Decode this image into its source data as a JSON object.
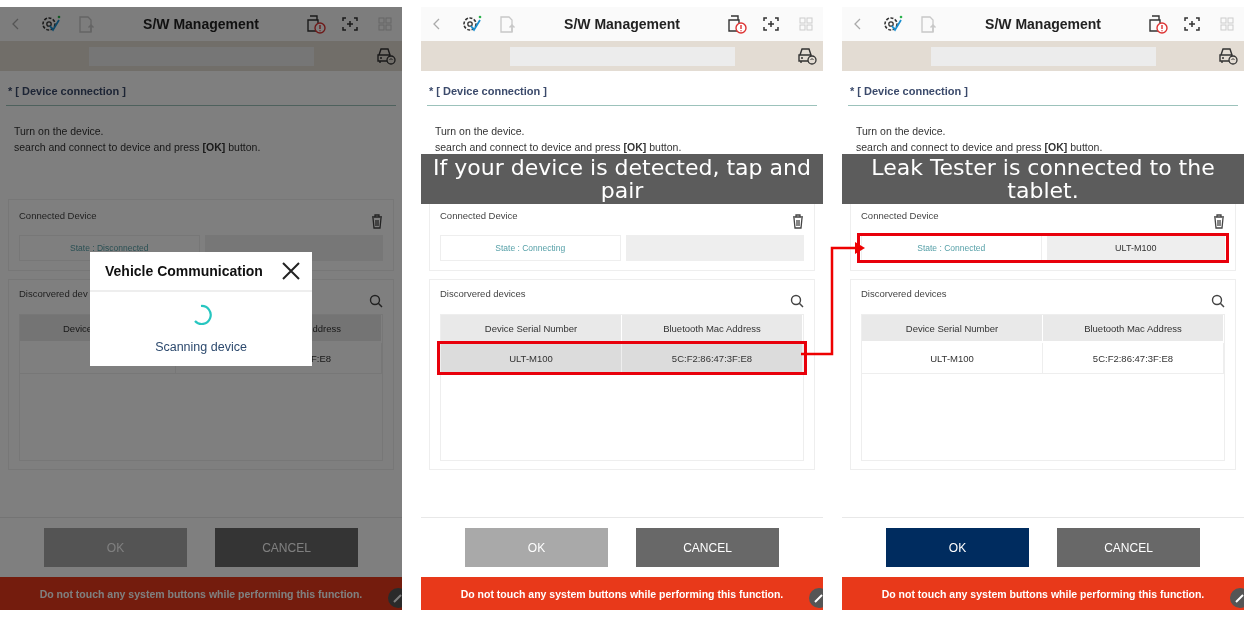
{
  "panels": [
    {
      "title": "S/W Management",
      "section": "* [ Device connection ]",
      "instructions": [
        "Turn on the device.",
        "search and connect to device and press **[OK]** button."
      ],
      "connected": {
        "title": "Connected Device",
        "state": "State : Disconnected",
        "highlighted": false
      },
      "discovered": {
        "title": "Discorvered dev",
        "columns": [
          "Device",
          "ddress"
        ],
        "rows": [
          {
            "mac": "F:E8",
            "selected": false,
            "highlighted": false
          }
        ]
      },
      "buttons": {
        "ok": "OK",
        "cancel": "CANCEL",
        "ok_enabled": false
      },
      "warning": "Do not touch any system buttons while performing this function.",
      "dimmed": true,
      "dialog": {
        "title": "Vehicle Communication",
        "message": "Scanning device"
      }
    },
    {
      "title": "S/W Management",
      "section": "* [ Device connection ]",
      "instructions": [
        "Turn on the device.",
        "search and connect to device and press **[OK]** button."
      ],
      "caption": "If your device is detected, tap and pair",
      "connected": {
        "title": "Connected Device",
        "state": "State : Connecting",
        "highlighted": false
      },
      "discovered": {
        "title": "Discorvered devices",
        "columns": [
          "Device Serial Number",
          "Bluetooth Mac Address"
        ],
        "rows": [
          {
            "serial": "ULT-M100",
            "mac": "5C:F2:86:47:3F:E8",
            "selected": true,
            "highlighted": true
          }
        ]
      },
      "buttons": {
        "ok": "OK",
        "cancel": "CANCEL",
        "ok_enabled": false
      },
      "warning": "Do not touch any system buttons while performing this function.",
      "dimmed": false
    },
    {
      "title": "S/W Management",
      "section": "* [ Device connection ]",
      "instructions": [
        "Turn on the device.",
        "search and connect to device and press **[OK]** button."
      ],
      "caption": "Leak Tester is connected to the tablet.",
      "connected": {
        "title": "Connected Device",
        "state": "State : Connected",
        "device": "ULT-M100",
        "highlighted": true
      },
      "discovered": {
        "title": "Discorvered devices",
        "columns": [
          "Device Serial Number",
          "Bluetooth Mac Address"
        ],
        "rows": [
          {
            "serial": "ULT-M100",
            "mac": "5C:F2:86:47:3F:E8",
            "selected": false,
            "highlighted": false
          }
        ]
      },
      "buttons": {
        "ok": "OK",
        "cancel": "CANCEL",
        "ok_enabled": true
      },
      "warning": "Do not touch any system buttons while performing this function.",
      "dimmed": false
    }
  ]
}
